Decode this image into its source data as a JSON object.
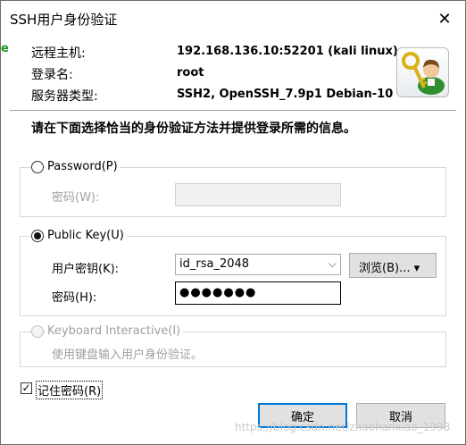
{
  "window": {
    "title": "SSH用户身份验证",
    "close_glyph": "✕"
  },
  "edge_glyph": "e",
  "info": {
    "host_label": "远程主机:",
    "host_value": "192.168.136.10:52201 (kali linux)",
    "login_label": "登录名:",
    "login_value": "root",
    "server_label": "服务器类型:",
    "server_value": "SSH2, OpenSSH_7.9p1 Debian-10"
  },
  "icon": {
    "name": "key-user-icon",
    "key_color": "#d9b21a",
    "user_color": "#2f8f2f"
  },
  "heading": "请在下面选择恰当的身份验证方法并提供登录所需的信息。",
  "password_group": {
    "label": "Password(P)",
    "field_label": "密码(W):",
    "value": "",
    "selected": false
  },
  "pubkey_group": {
    "label": "Public Key(U)",
    "selected": true,
    "key_label": "用户密钥(K):",
    "key_value": "id_rsa_2048",
    "browse_label": "浏览(B)... ▾",
    "pass_label": "密码(H):",
    "pass_value": "●●●●●●●"
  },
  "kbd_group": {
    "label": "Keyboard Interactive(I)",
    "description": "使用键盘输入用户身份验证。",
    "selected": false
  },
  "remember": {
    "label": "记住密码(R)",
    "checked": true,
    "check_glyph": "✓"
  },
  "buttons": {
    "ok": "确定",
    "cancel": "取消"
  },
  "watermark": "https://blog.csdn.net/zhaohanxiao_1998"
}
